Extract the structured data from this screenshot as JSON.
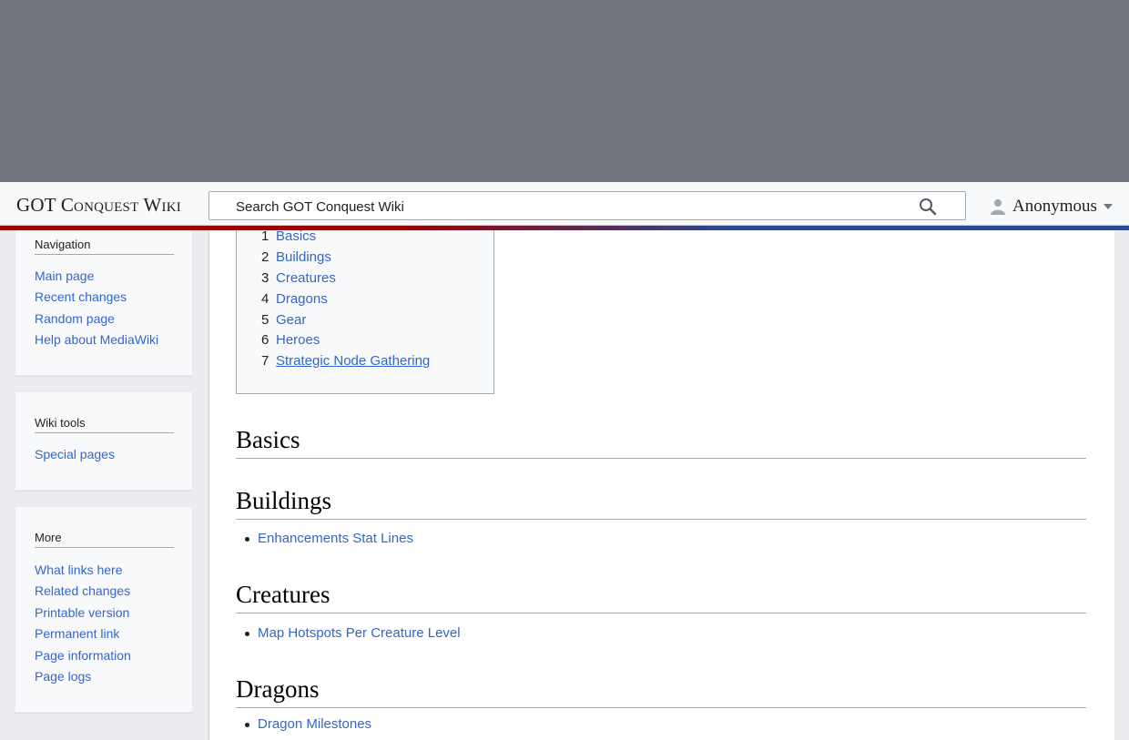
{
  "site": {
    "title": "GOT Conquest Wiki"
  },
  "search": {
    "placeholder": "Search GOT Conquest Wiki"
  },
  "user": {
    "label": "Anonymous"
  },
  "sidebar": {
    "navigation": {
      "heading": "Navigation",
      "items": [
        "Main page",
        "Recent changes",
        "Random page",
        "Help about MediaWiki"
      ]
    },
    "wiki_tools": {
      "heading": "Wiki tools",
      "items": [
        "Special pages"
      ]
    },
    "more": {
      "heading": "More",
      "items": [
        "What links here",
        "Related changes",
        "Printable version",
        "Permanent link",
        "Page information",
        "Page logs"
      ]
    }
  },
  "toc": {
    "items": [
      {
        "num": "1",
        "label": "Basics"
      },
      {
        "num": "2",
        "label": "Buildings"
      },
      {
        "num": "3",
        "label": "Creatures"
      },
      {
        "num": "4",
        "label": "Dragons"
      },
      {
        "num": "5",
        "label": "Gear"
      },
      {
        "num": "6",
        "label": "Heroes"
      },
      {
        "num": "7",
        "label": "Strategic Node Gathering"
      }
    ]
  },
  "sections": [
    {
      "heading": "Basics",
      "links": []
    },
    {
      "heading": "Buildings",
      "links": [
        "Enhancements Stat Lines"
      ]
    },
    {
      "heading": "Creatures",
      "links": [
        "Map Hotspots Per Creature Level"
      ]
    },
    {
      "heading": "Dragons",
      "links": [
        "Dragon Milestones"
      ]
    }
  ],
  "colors": {
    "link": "#3366cc",
    "top_band": "#72777d",
    "stripe_red": "#990000",
    "stripe_blue": "#2a4b8d"
  }
}
